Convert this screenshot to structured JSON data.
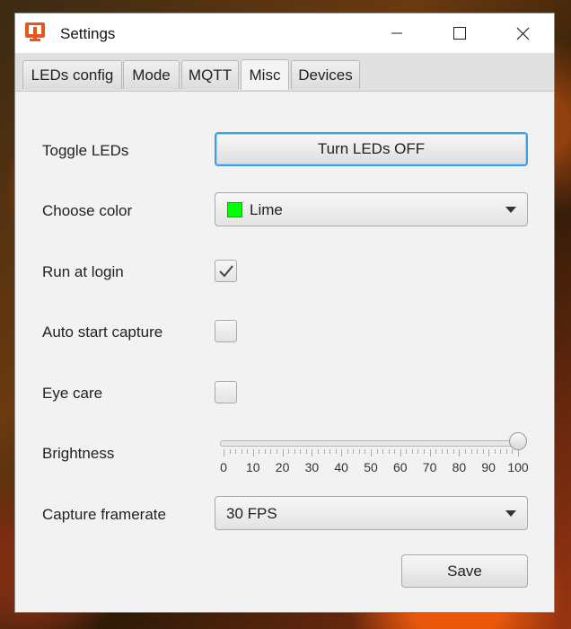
{
  "window": {
    "title": "Settings"
  },
  "tabs": [
    {
      "label": "LEDs config",
      "active": false
    },
    {
      "label": "Mode",
      "active": false
    },
    {
      "label": "MQTT",
      "active": false
    },
    {
      "label": "Misc",
      "active": true
    },
    {
      "label": "Devices",
      "active": false
    }
  ],
  "misc": {
    "toggle_leds": {
      "label": "Toggle LEDs",
      "button": "Turn LEDs OFF"
    },
    "choose_color": {
      "label": "Choose color",
      "value": "Lime",
      "swatch": "#00ff00"
    },
    "run_at_login": {
      "label": "Run at login",
      "checked": true
    },
    "auto_start_capture": {
      "label": "Auto start capture",
      "checked": false
    },
    "eye_care": {
      "label": "Eye care",
      "checked": false
    },
    "brightness": {
      "label": "Brightness",
      "value": 100,
      "min": 0,
      "max": 100,
      "tick_labels": [
        "0",
        "10",
        "20",
        "30",
        "40",
        "50",
        "60",
        "70",
        "80",
        "90",
        "100"
      ]
    },
    "capture_framerate": {
      "label": "Capture framerate",
      "value": "30 FPS"
    },
    "save": "Save"
  },
  "colors": {
    "app_icon": "#e8561e",
    "focus": "#3d9ee8"
  }
}
